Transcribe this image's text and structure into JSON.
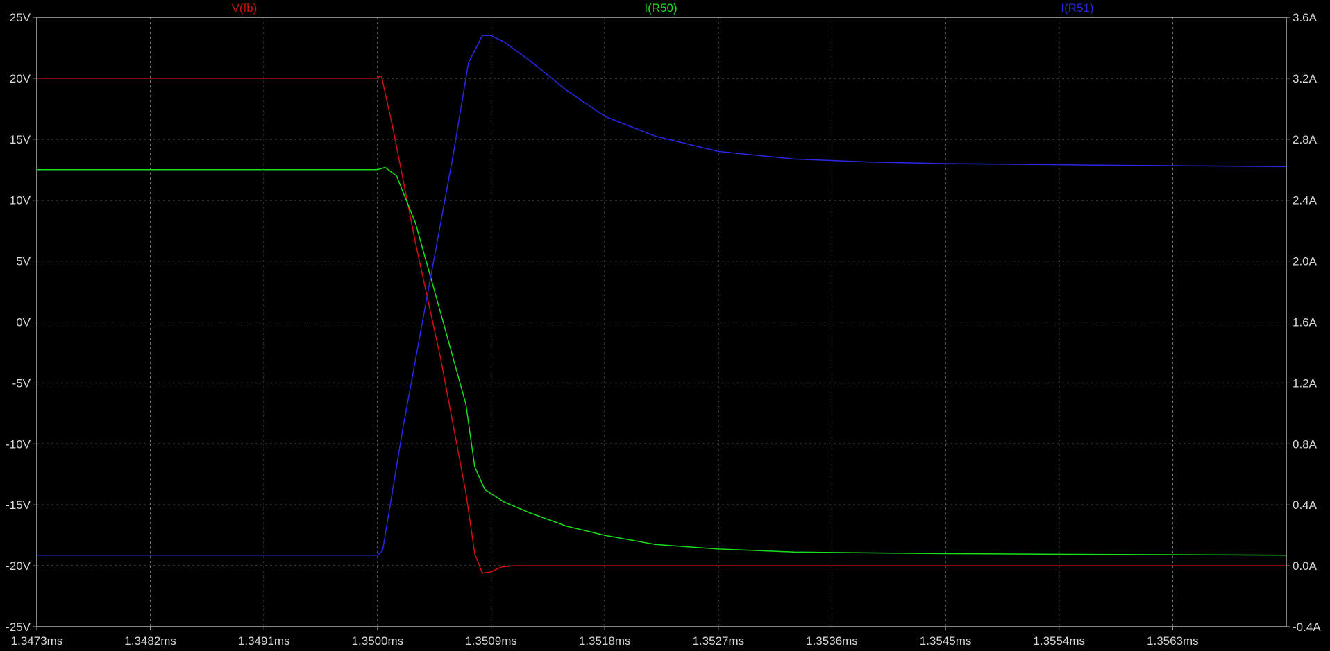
{
  "chart_data": {
    "type": "line",
    "grid": true,
    "background": "#000000",
    "frame_color": "#b0b0b0",
    "grid_color": "#8a8a8a",
    "x_axis": {
      "unit": "ms",
      "range": [
        1.3473,
        1.3572
      ],
      "ticks": [
        1.3473,
        1.3482,
        1.3491,
        1.35,
        1.3509,
        1.3518,
        1.3527,
        1.3536,
        1.3545,
        1.3554,
        1.3563
      ],
      "tick_labels": [
        "1.3473ms",
        "1.3482ms",
        "1.3491ms",
        "1.3500ms",
        "1.3509ms",
        "1.3518ms",
        "1.3527ms",
        "1.3536ms",
        "1.3545ms",
        "1.3554ms",
        "1.3563ms"
      ]
    },
    "y_left": {
      "unit": "V",
      "range": [
        -25,
        25
      ],
      "ticks": [
        25,
        20,
        15,
        10,
        5,
        0,
        -5,
        -10,
        -15,
        -20,
        -25
      ],
      "tick_labels": [
        "25V",
        "20V",
        "15V",
        "10V",
        "5V",
        "0V",
        "-5V",
        "-10V",
        "-15V",
        "-20V",
        "-25V"
      ]
    },
    "y_right": {
      "unit": "A",
      "range": [
        -0.4,
        3.6
      ],
      "ticks": [
        3.6,
        3.2,
        2.8,
        2.4,
        2.0,
        1.6,
        1.2,
        0.8,
        0.4,
        0.0,
        -0.4
      ],
      "tick_labels": [
        "3.6A",
        "3.2A",
        "2.8A",
        "2.4A",
        "2.0A",
        "1.6A",
        "1.2A",
        "0.8A",
        "0.4A",
        "0.0A",
        "-0.4A"
      ]
    },
    "series": [
      {
        "name": "V(fb)",
        "color": "#d01010",
        "axis": "left",
        "points": [
          [
            1.3473,
            20
          ],
          [
            1.34999,
            20
          ],
          [
            1.35003,
            20.2
          ],
          [
            1.35012,
            16
          ],
          [
            1.3503,
            6.5
          ],
          [
            1.3505,
            -3
          ],
          [
            1.3507,
            -14
          ],
          [
            1.35077,
            -19
          ],
          [
            1.35083,
            -20.6
          ],
          [
            1.3509,
            -20.5
          ],
          [
            1.35098,
            -20.1
          ],
          [
            1.35108,
            -20
          ],
          [
            1.3572,
            -20
          ]
        ]
      },
      {
        "name": "I(R50)",
        "color": "#18e018",
        "axis": "right",
        "points": [
          [
            1.3473,
            2.6
          ],
          [
            1.35,
            2.6
          ],
          [
            1.35006,
            2.615
          ],
          [
            1.35015,
            2.56
          ],
          [
            1.3503,
            2.25
          ],
          [
            1.3505,
            1.66
          ],
          [
            1.3507,
            1.06
          ],
          [
            1.35077,
            0.65
          ],
          [
            1.35085,
            0.5
          ],
          [
            1.351,
            0.42
          ],
          [
            1.3512,
            0.35
          ],
          [
            1.3515,
            0.26
          ],
          [
            1.3518,
            0.2
          ],
          [
            1.3522,
            0.14
          ],
          [
            1.3527,
            0.11
          ],
          [
            1.3533,
            0.09
          ],
          [
            1.3545,
            0.08
          ],
          [
            1.3557,
            0.075
          ],
          [
            1.3572,
            0.07
          ]
        ]
      },
      {
        "name": "I(R51)",
        "color": "#2828e8",
        "axis": "right",
        "points": [
          [
            1.3473,
            0.07
          ],
          [
            1.35,
            0.07
          ],
          [
            1.35004,
            0.1
          ],
          [
            1.3502,
            0.9
          ],
          [
            1.3504,
            1.8
          ],
          [
            1.3506,
            2.7
          ],
          [
            1.35072,
            3.3
          ],
          [
            1.35083,
            3.48
          ],
          [
            1.3509,
            3.48
          ],
          [
            1.351,
            3.44
          ],
          [
            1.3512,
            3.32
          ],
          [
            1.3515,
            3.12
          ],
          [
            1.3518,
            2.95
          ],
          [
            1.3522,
            2.82
          ],
          [
            1.3527,
            2.72
          ],
          [
            1.3533,
            2.67
          ],
          [
            1.3539,
            2.65
          ],
          [
            1.3545,
            2.64
          ],
          [
            1.3557,
            2.63
          ],
          [
            1.3572,
            2.62
          ]
        ]
      }
    ]
  }
}
